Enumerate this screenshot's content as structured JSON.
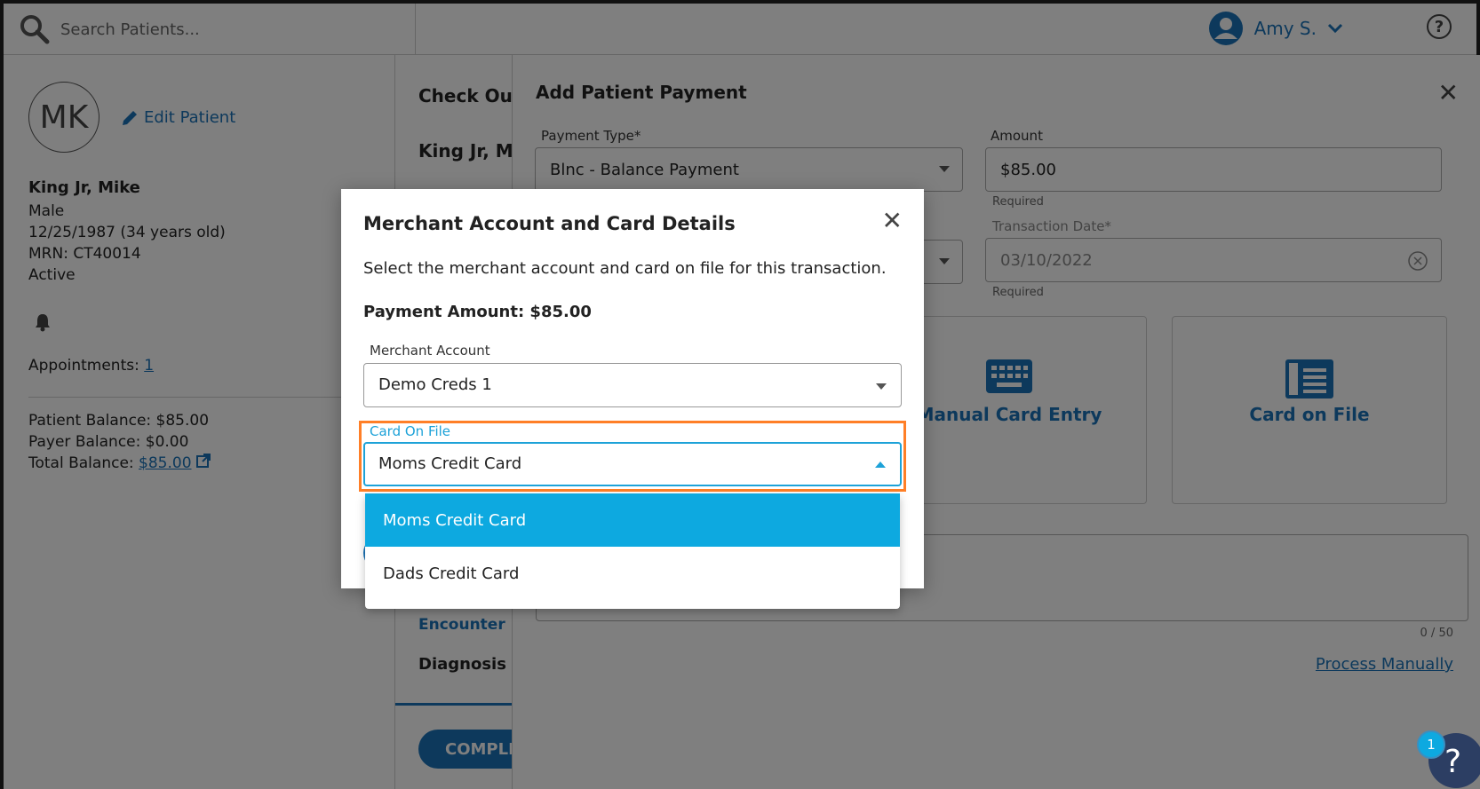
{
  "topbar": {
    "search_placeholder": "Search Patients...",
    "user_name": "Amy S."
  },
  "patient": {
    "initials": "MK",
    "edit_label": "Edit Patient",
    "name": "King Jr, Mike",
    "sex": "Male",
    "dob": "12/25/1987 (34 years old)",
    "mrn": "MRN: CT40014",
    "status": "Active",
    "appointments_label": "Appointments:",
    "appointments_count": "1",
    "patient_balance": "Patient Balance: $85.00",
    "payer_balance": "Payer Balance: $0.00",
    "total_balance_label": "Total Balance:",
    "total_balance_value": "$85.00"
  },
  "checkout": {
    "title": "Check Out",
    "patient_name": "King Jr, Mik",
    "encounter_label": "Encounter D",
    "diagnosis_label": "Diagnosis",
    "complete_label": "COMPLE"
  },
  "payment_sheet": {
    "title": "Add Patient Payment",
    "payment_type_label": "Payment Type*",
    "payment_type_value": "Blnc - Balance Payment",
    "amount_label": "Amount",
    "amount_value": "$85.00",
    "required_text": "Required",
    "transaction_date_label": "Transaction Date*",
    "transaction_date_value": "03/10/2022",
    "manual_card_label": "Manual Card Entry",
    "card_on_file_label": "Card on File",
    "notes_count": "0 / 50",
    "process_manually_label": "Process Manually"
  },
  "modal": {
    "title": "Merchant Account and Card Details",
    "description": "Select the merchant account and card on file for this transaction.",
    "payment_amount": "Payment Amount: $85.00",
    "merchant_label": "Merchant Account",
    "merchant_value": "Demo Creds 1",
    "card_label": "Card On File",
    "card_value": "Moms Credit Card",
    "options": [
      "Moms Credit Card",
      "Dads Credit Card"
    ]
  },
  "help": {
    "badge_count": "1",
    "fab_label": "?"
  },
  "colors": {
    "accent": "#1da2d8",
    "selected_option": "#0da9e0",
    "highlight": "#ff7f27",
    "link": "#1a73b8"
  }
}
